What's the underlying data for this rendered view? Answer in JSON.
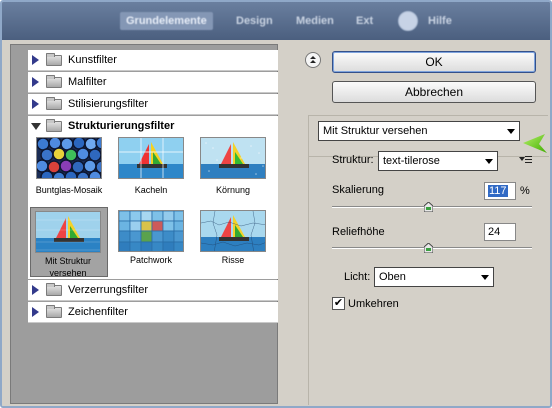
{
  "topbar": {
    "items": [
      "Grundelemente",
      "Design",
      "Medien",
      "Ext",
      "Hilfe"
    ]
  },
  "categories": [
    {
      "label": "Kunstfilter",
      "open": false
    },
    {
      "label": "Malfilter",
      "open": false
    },
    {
      "label": "Stilisierungsfilter",
      "open": false
    },
    {
      "label": "Strukturierungsfilter",
      "open": true
    },
    {
      "label": "Verzerrungsfilter",
      "open": false
    },
    {
      "label": "Zeichenfilter",
      "open": false
    }
  ],
  "thumbnails": [
    {
      "label": "Buntglas-Mosaik",
      "icon": "stained-glass-thumbnail"
    },
    {
      "label": "Kacheln",
      "icon": "tiles-thumbnail"
    },
    {
      "label": "Körnung",
      "icon": "grain-thumbnail"
    },
    {
      "label": "Mit Struktur versehen",
      "icon": "texturizer-thumbnail",
      "selected": true
    },
    {
      "label": "Patchwork",
      "icon": "patchwork-thumbnail"
    },
    {
      "label": "Risse",
      "icon": "craquelure-thumbnail"
    }
  ],
  "buttons": {
    "ok": "OK",
    "cancel": "Abbrechen"
  },
  "filter_select": {
    "value": "Mit Struktur versehen"
  },
  "settings": {
    "struktur_label": "Struktur:",
    "struktur_value": "text-tilerose",
    "skalierung_label": "Skalierung",
    "skalierung_value": "117",
    "skalierung_unit": "%",
    "skalierung_level": 0.48,
    "reliefhoehe_label": "Reliefhöhe",
    "reliefhoehe_value": "24",
    "reliefhoehe_level": 0.48,
    "licht_label": "Licht:",
    "licht_value": "Oben",
    "umkehren_label": "Umkehren",
    "umkehren_checked": true
  },
  "colors": {
    "accent_blue": "#316ac5",
    "highlight_arrow": "#5ec400"
  }
}
